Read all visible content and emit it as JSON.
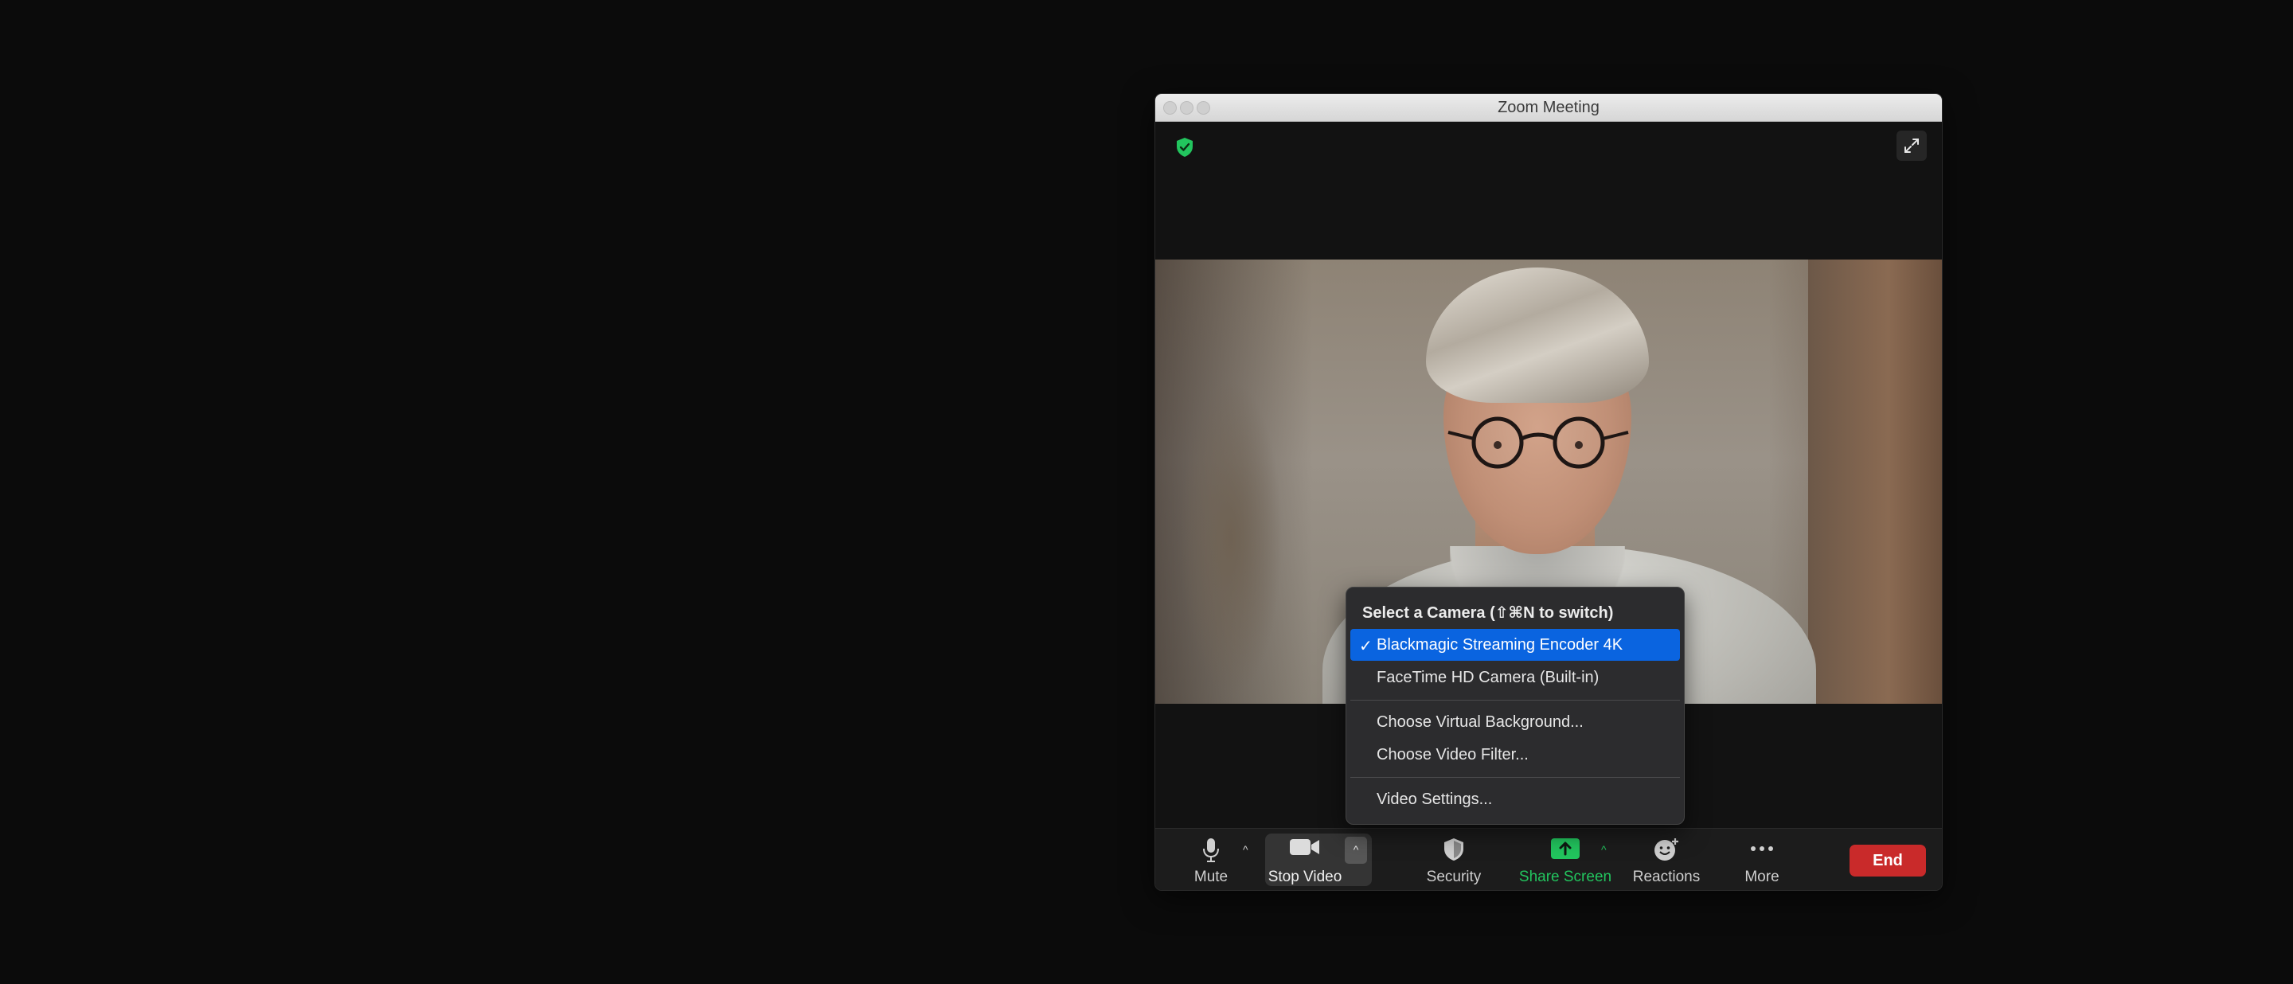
{
  "window": {
    "title": "Zoom Meeting"
  },
  "camera_menu": {
    "header": "Select a Camera (⇧⌘N to switch)",
    "items": [
      {
        "label": "Blackmagic Streaming Encoder 4K",
        "checked": "✓"
      },
      {
        "label": "FaceTime HD Camera (Built-in)"
      }
    ],
    "options": [
      {
        "label": "Choose Virtual Background..."
      },
      {
        "label": "Choose Video Filter..."
      }
    ],
    "settings": {
      "label": "Video Settings..."
    }
  },
  "toolbar": {
    "mute": "Mute",
    "stop_video": "Stop Video",
    "security": "Security",
    "share_screen": "Share Screen",
    "reactions": "Reactions",
    "more": "More",
    "end": "End"
  },
  "colors": {
    "share_green": "#22c55e",
    "end_red": "#c92a2a",
    "menu_highlight": "#0a64e0",
    "shield_green": "#22c55e"
  }
}
